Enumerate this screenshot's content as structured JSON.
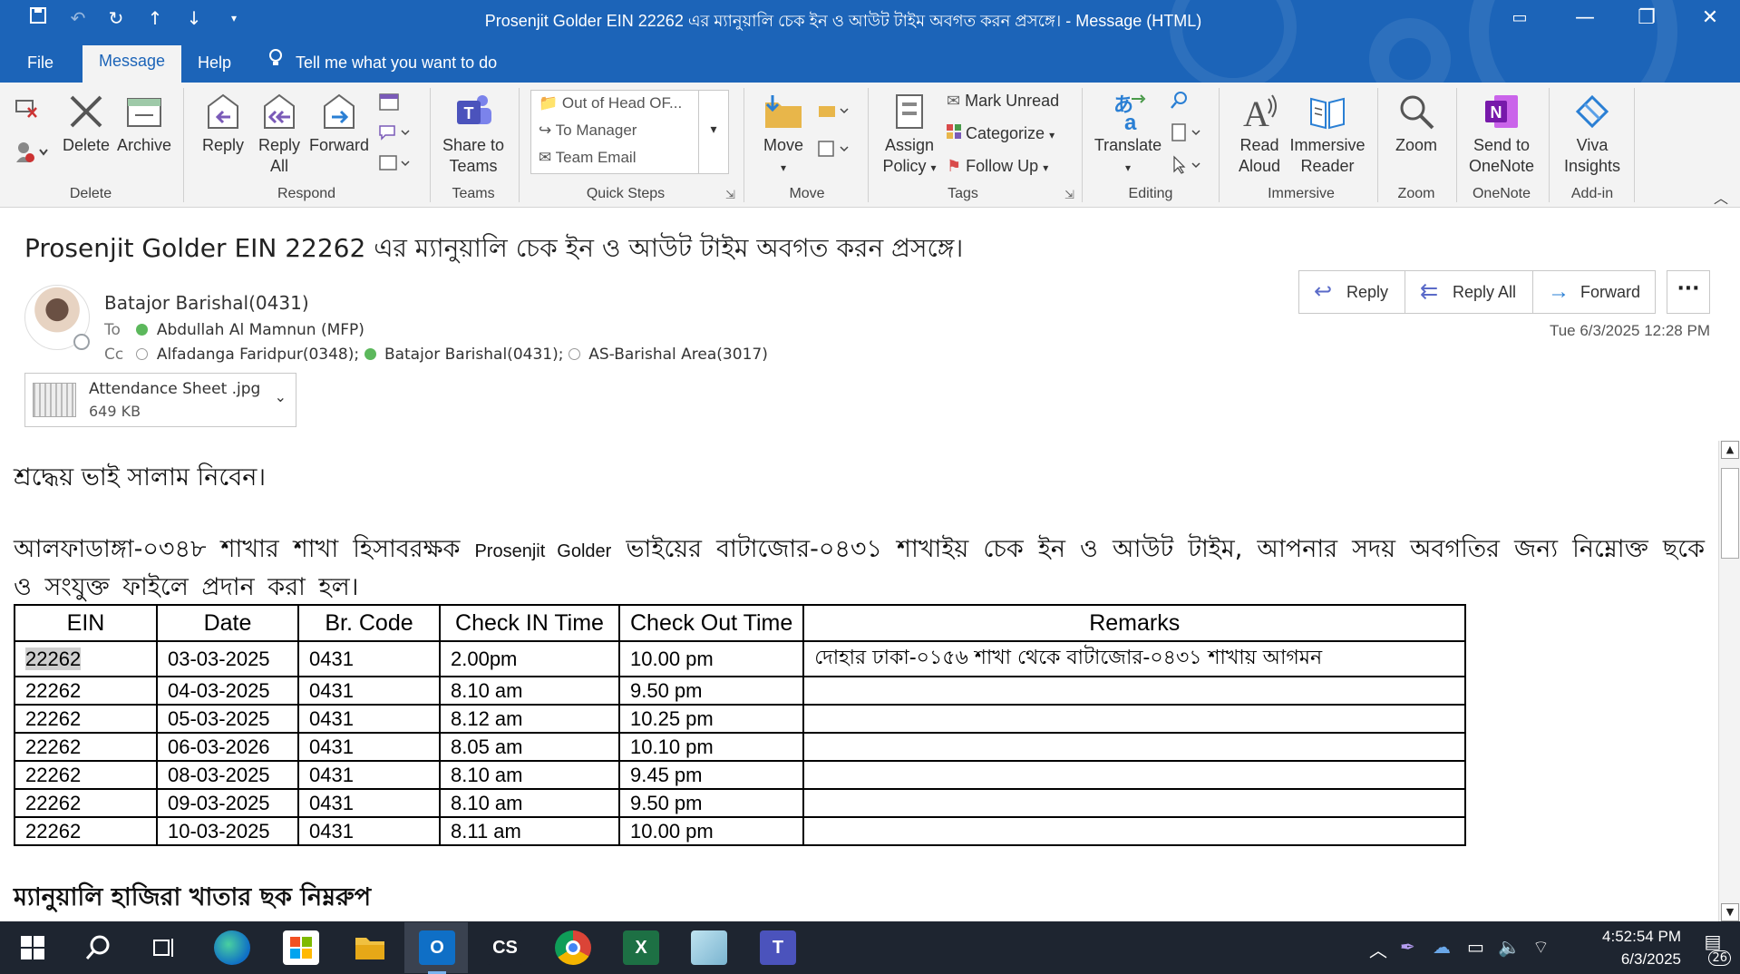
{
  "window": {
    "title": "Prosenjit Golder EIN 22262  এর ম্যানুয়ালি চেক ইন ও আউট টাইম অবগত করন প্রসঙ্গে। - Message (HTML)",
    "controls": [
      "▭",
      "—",
      "❐",
      "✕"
    ]
  },
  "quick_access": {
    "icons": [
      "save-icon",
      "undo-icon",
      "redo-icon",
      "up-arrow-icon",
      "down-arrow-icon",
      "customize-icon"
    ]
  },
  "tabs": [
    {
      "label": "File",
      "active": false
    },
    {
      "label": "Message",
      "active": true
    },
    {
      "label": "Help",
      "active": false
    }
  ],
  "tell_me": "Tell me what you want to do",
  "ribbon": {
    "delete": {
      "delete_label": "Delete",
      "archive_label": "Archive",
      "group": "Delete"
    },
    "respond": {
      "reply": "Reply",
      "reply_all_1": "Reply",
      "reply_all_2": "All",
      "forward": "Forward",
      "group": "Respond"
    },
    "teams": {
      "share_1": "Share to",
      "share_2": "Teams",
      "group": "Teams"
    },
    "quick_steps": {
      "items": [
        "Out of Head OF...",
        "To Manager",
        "Team Email"
      ],
      "group": "Quick Steps"
    },
    "move": {
      "move_label": "Move",
      "group": "Move"
    },
    "tags": {
      "assign_1": "Assign",
      "assign_2": "Policy",
      "mark_unread": "Mark Unread",
      "categorize": "Categorize",
      "follow_up": "Follow Up",
      "group": "Tags"
    },
    "editing": {
      "translate": "Translate",
      "group": "Editing"
    },
    "immersive": {
      "read_1": "Read",
      "read_2": "Aloud",
      "reader_1": "Immersive",
      "reader_2": "Reader",
      "group": "Immersive"
    },
    "zoom": {
      "zoom_label": "Zoom",
      "group": "Zoom"
    },
    "onenote": {
      "send_1": "Send to",
      "send_2": "OneNote",
      "group": "OneNote"
    },
    "addin": {
      "viva_1": "Viva",
      "viva_2": "Insights",
      "group": "Add-in"
    }
  },
  "message": {
    "subject": "Prosenjit Golder EIN 22262  এর ম্যানুয়ালি চেক ইন ও আউট টাইম অবগত করন প্রসঙ্গে।",
    "sender": "Batajor Barishal(0431)",
    "to_label": "To",
    "to": "Abdullah Al Mamnun (MFP)",
    "cc_label": "Cc",
    "cc": [
      {
        "name": "Alfadanga Faridpur(0348);",
        "status": "empty"
      },
      {
        "name": "Batajor Barishal(0431);",
        "status": "green"
      },
      {
        "name": "AS-Barishal Area(3017)",
        "status": "empty"
      }
    ],
    "sent": "Tue 6/3/2025 12:28 PM",
    "attachment": {
      "name": "Attendance Sheet .jpg",
      "size": "649 KB"
    },
    "actions": {
      "reply": "Reply",
      "reply_all": "Reply All",
      "forward": "Forward",
      "more": "···"
    }
  },
  "body": {
    "greeting": "শ্রদ্ধেয় ভাই সালাম নিবেন।",
    "intro_1": "আলফাডাঙ্গা-০৩৪৮ শাখার শাখা হিসাবরক্ষক ",
    "intro_name": "Prosenjit Golder",
    "intro_2": " ভাইয়ের বাটাজোর-০৪৩১ শাখাইয় চেক ইন ও আউট টাইম, আপনার সদয় অবগতির জন্য নিম্নোক্ত ছকে ও সংযুক্ত ফাইলে প্রদান করা হল।",
    "table": {
      "headers": [
        "EIN",
        "Date",
        "Br. Code",
        "Check IN Time",
        "Check Out Time",
        "Remarks"
      ],
      "rows": [
        [
          "22262",
          "03-03-2025",
          "0431",
          "2.00pm",
          "10.00 pm",
          "দোহার ঢাকা-০১৫৬ শাখা  থেকে বাটাজোর-০৪৩১ শাখায় আগমন"
        ],
        [
          "22262",
          "04-03-2025",
          "0431",
          "8.10 am",
          "9.50 pm",
          ""
        ],
        [
          "22262",
          "05-03-2025",
          "0431",
          "8.12 am",
          "10.25 pm",
          ""
        ],
        [
          "22262",
          "06-03-2026",
          "0431",
          "8.05 am",
          "10.10 pm",
          ""
        ],
        [
          "22262",
          "08-03-2025",
          "0431",
          "8.10 am",
          "9.45 pm",
          ""
        ],
        [
          "22262",
          "09-03-2025",
          "0431",
          "8.10 am",
          "9.50 pm",
          ""
        ],
        [
          "22262",
          "10-03-2025",
          "0431",
          "8.11 am",
          "10.00 pm",
          ""
        ]
      ]
    },
    "footer_heading": "ম্যানুয়ালি হাজিরা খাতার ছক নিম্নরুপ"
  },
  "taskbar": {
    "apps": [
      "windows-icon",
      "search-icon",
      "task-view-icon",
      "edge-icon",
      "store-icon",
      "file-explorer-icon",
      "outlook-icon",
      "cs-app-icon",
      "chrome-icon",
      "excel-icon",
      "notepad-icon",
      "teams-icon"
    ],
    "cs_label": "CS",
    "time": "4:52:54 PM",
    "date": "6/3/2025",
    "notifications": "26"
  },
  "colors": {
    "titlebar": "#1c64b8",
    "ribbon": "#f3f3f3",
    "taskbar": "#1e2530",
    "presence_green": "#5cb85c"
  }
}
